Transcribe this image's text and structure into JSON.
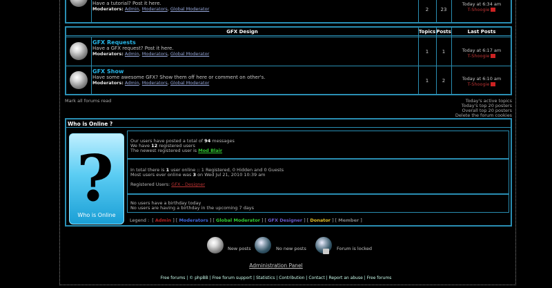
{
  "top_partial": {
    "desc": "Have a tutorial? Post it here.",
    "mods_label": "Moderators:",
    "mods": [
      "Admin",
      "Moderators",
      "Global Moderator"
    ],
    "topics": "2",
    "posts": "23",
    "last_time": "Today at 6:34 am",
    "last_user": "T-Shoogie"
  },
  "gfx": {
    "header": {
      "title": "GFX Design",
      "topics": "Topics",
      "posts": "Posts",
      "last": "Last Posts"
    },
    "forums": [
      {
        "title": "GFX Requests",
        "desc": "Have a GFX request? Post it here.",
        "mods_label": "Moderators:",
        "mods": [
          "Admin",
          "Moderators",
          "Global Moderator"
        ],
        "topics": "1",
        "posts": "1",
        "last_time": "Today at 6:17 am",
        "last_user": "T-Shoogie"
      },
      {
        "title": "GFX Show",
        "desc": "Have some awesome GFX? Show them off here or comment on other's.",
        "mods_label": "Moderators:",
        "mods": [
          "Admin",
          "Moderators",
          "Global Moderator"
        ],
        "topics": "1",
        "posts": "2",
        "last_time": "Today at 6:10 am",
        "last_user": "T-Shoogie"
      }
    ]
  },
  "links": {
    "mark_read": "Mark all forums read",
    "active": "Today's active topics",
    "top_today": "Today's top 20 posters",
    "top_overall": "Overall top 20 posters",
    "delete_cookies": "Delete the forum cookies"
  },
  "online": {
    "title": "Who is Online ?",
    "image_caption": "Who is Online",
    "stats1": "Our users have posted a total of",
    "total_messages": "94",
    "stats1_end": "messages",
    "stats2_pre": "We have",
    "registered": "12",
    "stats2_end": "registered users",
    "newest_label": "The newest registered user is",
    "newest_user": "Mod Blair",
    "in_total_pre": "In total there is",
    "online_count": "1",
    "in_total_end": "user online :: 1 Registered, 0 Hidden and 0 Guests",
    "most_pre": "Most users ever online was",
    "most_count": "3",
    "most_end": "on Wed Jul 21, 2010 10:39 am",
    "reg_users_label": "Registered Users:",
    "reg_users": "GFX - Designer",
    "bday1": "No users have a birthday today",
    "bday2": "No users are having a birthday in the upcoming 7 days",
    "legend_label": "Legend :",
    "legend": [
      {
        "name": "Admin",
        "color": "#b22222"
      },
      {
        "name": "Moderators",
        "color": "#4169e1"
      },
      {
        "name": "Global Moderator",
        "color": "#32cd32"
      },
      {
        "name": "GFX Designer",
        "color": "#6a5acd"
      },
      {
        "name": "Donator",
        "color": "#e6c229"
      },
      {
        "name": "Member",
        "color": "#808080"
      }
    ]
  },
  "key": {
    "new_posts": "New posts",
    "no_new_posts": "No new posts",
    "locked": "Forum is locked"
  },
  "admin_panel": "Administration Panel",
  "footer": [
    "Free forums",
    "©",
    "phpBB",
    "Free forum support",
    "Statistics",
    "Contribution",
    "Contact",
    "Report an abuse",
    "Free forums"
  ]
}
